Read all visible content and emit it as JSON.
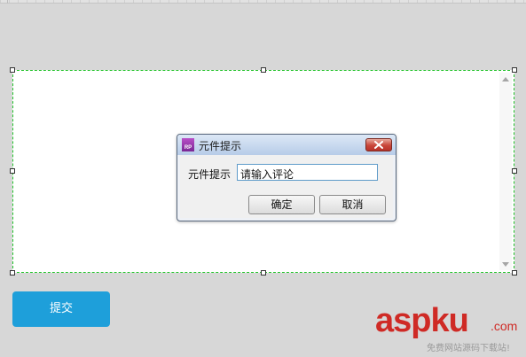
{
  "dialog": {
    "title": "元件提示",
    "app_icon_text": "RP",
    "field_label": "元件提示",
    "field_value": "请输入评论",
    "ok_label": "确定",
    "cancel_label": "取消"
  },
  "canvas": {
    "submit_label": "提交"
  },
  "watermark": {
    "main": "aspku",
    "suffix": ".com",
    "sub": "免费网站源码下载站!"
  },
  "colors": {
    "canvas_bg": "#d7d7d7",
    "selection_dash": "#22c22a",
    "submit_bg": "#1e9fda",
    "input_border": "#5f9bc9",
    "close_red": "#c9463a",
    "watermark_red": "#cf2a25"
  }
}
